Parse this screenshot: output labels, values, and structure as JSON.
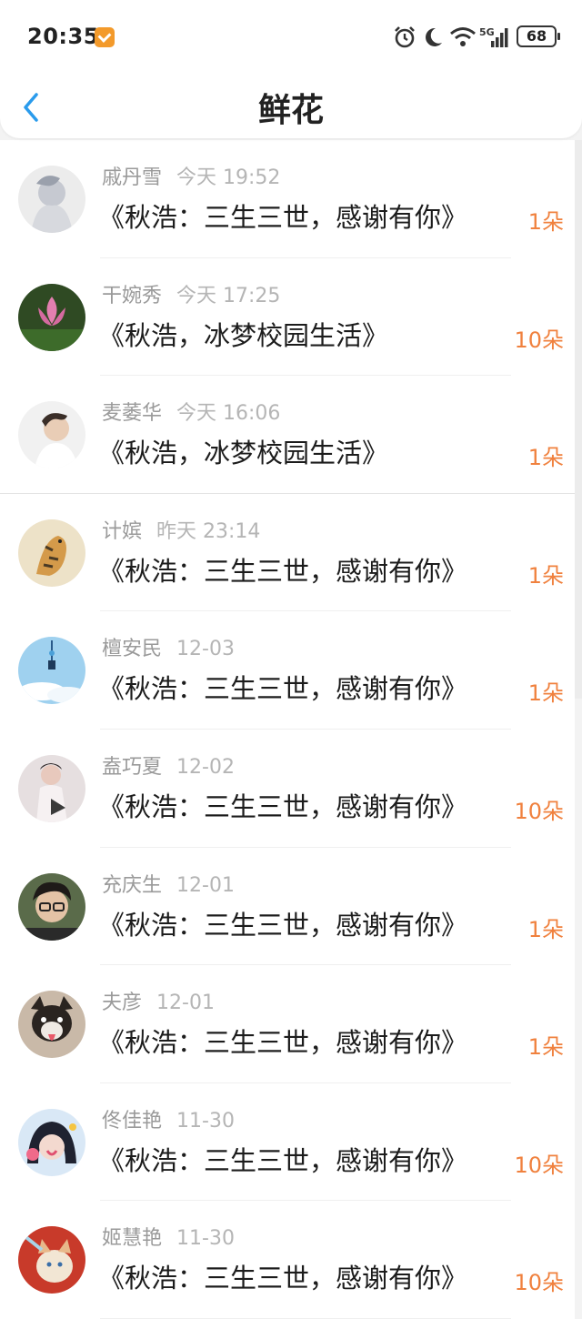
{
  "status": {
    "time": "20:35",
    "network": "5G",
    "battery": "68"
  },
  "header": {
    "title": "鲜花"
  },
  "items": [
    {
      "name": "戚丹雪",
      "date": "今天 19:52",
      "book": "《秋浩：三生三世，感谢有你》",
      "count": "1朵"
    },
    {
      "name": "干婉秀",
      "date": "今天 17:25",
      "book": "《秋浩，冰梦校园生活》",
      "count": "10朵"
    },
    {
      "name": "麦萎华",
      "date": "今天 16:06",
      "book": "《秋浩，冰梦校园生活》",
      "count": "1朵"
    },
    {
      "name": "计嫔",
      "date": "昨天 23:14",
      "book": "《秋浩：三生三世，感谢有你》",
      "count": "1朵"
    },
    {
      "name": "檀安民",
      "date": "12-03",
      "book": "《秋浩：三生三世，感谢有你》",
      "count": "1朵"
    },
    {
      "name": "盍巧夏",
      "date": "12-02",
      "book": "《秋浩：三生三世，感谢有你》",
      "count": "10朵"
    },
    {
      "name": "充庆生",
      "date": "12-01",
      "book": "《秋浩：三生三世，感谢有你》",
      "count": "1朵"
    },
    {
      "name": "夫彦",
      "date": "12-01",
      "book": "《秋浩：三生三世，感谢有你》",
      "count": "1朵"
    },
    {
      "name": "佟佳艳",
      "date": "11-30",
      "book": "《秋浩：三生三世，感谢有你》",
      "count": "10朵"
    },
    {
      "name": "姬慧艳",
      "date": "11-30",
      "book": "《秋浩：三生三世，感谢有你》",
      "count": "10朵"
    }
  ],
  "colors": {
    "accent": "#2a9bec",
    "count": "#f0813e",
    "name": "#9a9a9a"
  }
}
